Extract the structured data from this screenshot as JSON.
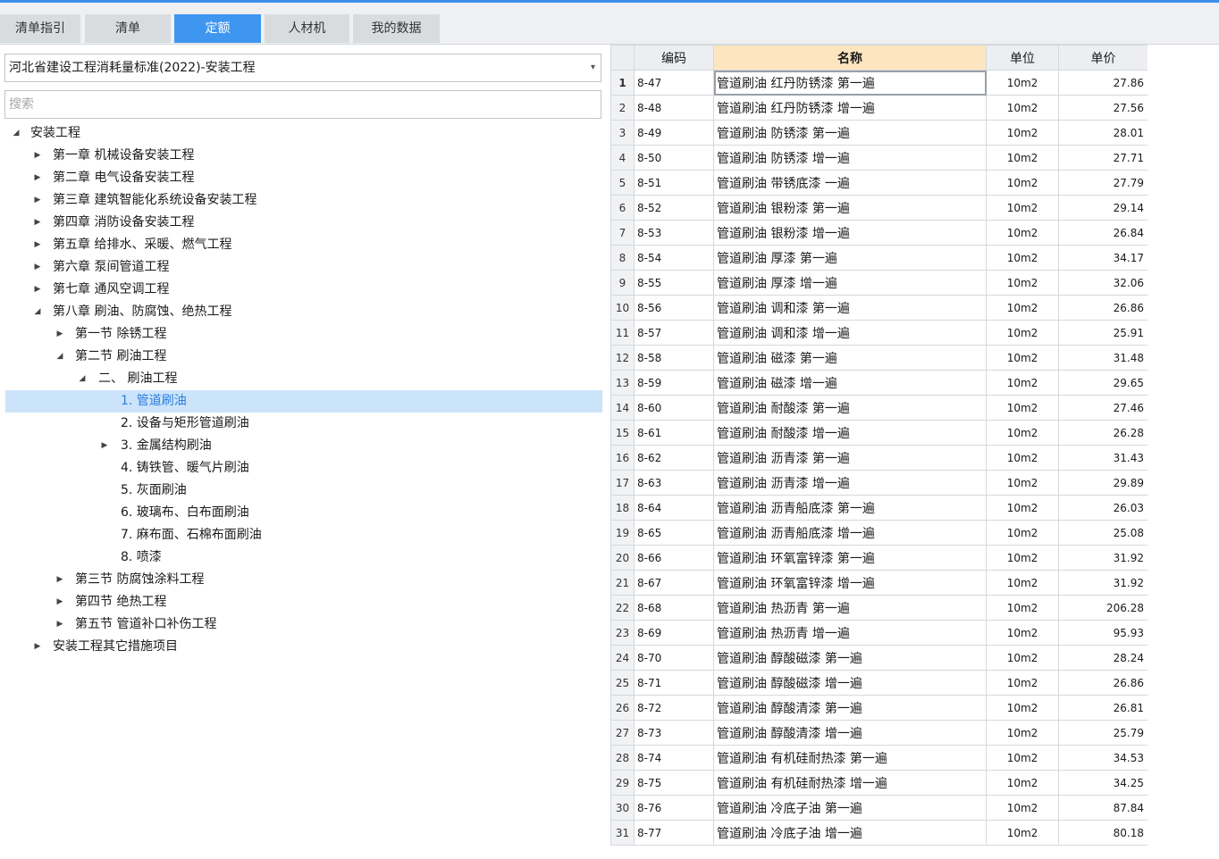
{
  "tabs": [
    {
      "label": "清单指引",
      "active": false
    },
    {
      "label": "清单",
      "active": false
    },
    {
      "label": "定额",
      "active": true
    },
    {
      "label": "人材机",
      "active": false
    },
    {
      "label": "我的数据",
      "active": false
    }
  ],
  "library": {
    "selected": "河北省建设工程消耗量标准(2022)-安装工程"
  },
  "search": {
    "placeholder": "搜索",
    "value": ""
  },
  "tree": [
    {
      "label": "安装工程",
      "level": 0,
      "toggle": "expanded"
    },
    {
      "label": "第一章 机械设备安装工程",
      "level": 1,
      "toggle": "collapsed"
    },
    {
      "label": "第二章 电气设备安装工程",
      "level": 1,
      "toggle": "collapsed"
    },
    {
      "label": "第三章 建筑智能化系统设备安装工程",
      "level": 1,
      "toggle": "collapsed"
    },
    {
      "label": "第四章 消防设备安装工程",
      "level": 1,
      "toggle": "collapsed"
    },
    {
      "label": "第五章 给排水、采暖、燃气工程",
      "level": 1,
      "toggle": "collapsed"
    },
    {
      "label": "第六章 泵间管道工程",
      "level": 1,
      "toggle": "collapsed"
    },
    {
      "label": "第七章 通风空调工程",
      "level": 1,
      "toggle": "collapsed"
    },
    {
      "label": "第八章 刷油、防腐蚀、绝热工程",
      "level": 1,
      "toggle": "expanded"
    },
    {
      "label": "第一节 除锈工程",
      "level": 2,
      "toggle": "collapsed"
    },
    {
      "label": "第二节 刷油工程",
      "level": 2,
      "toggle": "expanded"
    },
    {
      "label": "二、 刷油工程",
      "level": 3,
      "toggle": "expanded"
    },
    {
      "label": "1. 管道刷油",
      "level": 4,
      "toggle": "none",
      "selected": true
    },
    {
      "label": "2. 设备与矩形管道刷油",
      "level": 4,
      "toggle": "none"
    },
    {
      "label": "3. 金属结构刷油",
      "level": 4,
      "toggle": "collapsed"
    },
    {
      "label": "4. 铸铁管、暖气片刷油",
      "level": 4,
      "toggle": "none"
    },
    {
      "label": "5. 灰面刷油",
      "level": 4,
      "toggle": "none"
    },
    {
      "label": "6. 玻璃布、白布面刷油",
      "level": 4,
      "toggle": "none"
    },
    {
      "label": "7. 麻布面、石棉布面刷油",
      "level": 4,
      "toggle": "none"
    },
    {
      "label": "8. 喷漆",
      "level": 4,
      "toggle": "none"
    },
    {
      "label": "第三节 防腐蚀涂料工程",
      "level": 2,
      "toggle": "collapsed"
    },
    {
      "label": "第四节 绝热工程",
      "level": 2,
      "toggle": "collapsed"
    },
    {
      "label": "第五节 管道补口补伤工程",
      "level": 2,
      "toggle": "collapsed"
    },
    {
      "label": "安装工程其它措施项目",
      "level": 1,
      "toggle": "collapsed"
    }
  ],
  "grid": {
    "columns": [
      "编码",
      "名称",
      "单位",
      "单价"
    ],
    "rows": [
      {
        "n": "1",
        "code": "8-47",
        "name": "管道刷油 红丹防锈漆 第一遍",
        "unit": "10m2",
        "price": "27.86"
      },
      {
        "n": "2",
        "code": "8-48",
        "name": "管道刷油 红丹防锈漆 增一遍",
        "unit": "10m2",
        "price": "27.56"
      },
      {
        "n": "3",
        "code": "8-49",
        "name": "管道刷油 防锈漆 第一遍",
        "unit": "10m2",
        "price": "28.01"
      },
      {
        "n": "4",
        "code": "8-50",
        "name": "管道刷油 防锈漆 增一遍",
        "unit": "10m2",
        "price": "27.71"
      },
      {
        "n": "5",
        "code": "8-51",
        "name": "管道刷油 带锈底漆 一遍",
        "unit": "10m2",
        "price": "27.79"
      },
      {
        "n": "6",
        "code": "8-52",
        "name": "管道刷油 银粉漆 第一遍",
        "unit": "10m2",
        "price": "29.14"
      },
      {
        "n": "7",
        "code": "8-53",
        "name": "管道刷油 银粉漆 增一遍",
        "unit": "10m2",
        "price": "26.84"
      },
      {
        "n": "8",
        "code": "8-54",
        "name": "管道刷油 厚漆 第一遍",
        "unit": "10m2",
        "price": "34.17"
      },
      {
        "n": "9",
        "code": "8-55",
        "name": "管道刷油 厚漆 增一遍",
        "unit": "10m2",
        "price": "32.06"
      },
      {
        "n": "10",
        "code": "8-56",
        "name": "管道刷油 调和漆 第一遍",
        "unit": "10m2",
        "price": "26.86"
      },
      {
        "n": "11",
        "code": "8-57",
        "name": "管道刷油 调和漆 增一遍",
        "unit": "10m2",
        "price": "25.91"
      },
      {
        "n": "12",
        "code": "8-58",
        "name": "管道刷油 磁漆 第一遍",
        "unit": "10m2",
        "price": "31.48"
      },
      {
        "n": "13",
        "code": "8-59",
        "name": "管道刷油 磁漆 增一遍",
        "unit": "10m2",
        "price": "29.65"
      },
      {
        "n": "14",
        "code": "8-60",
        "name": "管道刷油 耐酸漆 第一遍",
        "unit": "10m2",
        "price": "27.46"
      },
      {
        "n": "15",
        "code": "8-61",
        "name": "管道刷油 耐酸漆 增一遍",
        "unit": "10m2",
        "price": "26.28"
      },
      {
        "n": "16",
        "code": "8-62",
        "name": "管道刷油 沥青漆 第一遍",
        "unit": "10m2",
        "price": "31.43"
      },
      {
        "n": "17",
        "code": "8-63",
        "name": "管道刷油 沥青漆 增一遍",
        "unit": "10m2",
        "price": "29.89"
      },
      {
        "n": "18",
        "code": "8-64",
        "name": "管道刷油 沥青船底漆 第一遍",
        "unit": "10m2",
        "price": "26.03"
      },
      {
        "n": "19",
        "code": "8-65",
        "name": "管道刷油 沥青船底漆 增一遍",
        "unit": "10m2",
        "price": "25.08"
      },
      {
        "n": "20",
        "code": "8-66",
        "name": "管道刷油 环氧富锌漆 第一遍",
        "unit": "10m2",
        "price": "31.92"
      },
      {
        "n": "21",
        "code": "8-67",
        "name": "管道刷油 环氧富锌漆 增一遍",
        "unit": "10m2",
        "price": "31.92"
      },
      {
        "n": "22",
        "code": "8-68",
        "name": "管道刷油 热沥青 第一遍",
        "unit": "10m2",
        "price": "206.28"
      },
      {
        "n": "23",
        "code": "8-69",
        "name": "管道刷油 热沥青 增一遍",
        "unit": "10m2",
        "price": "95.93"
      },
      {
        "n": "24",
        "code": "8-70",
        "name": "管道刷油 醇酸磁漆 第一遍",
        "unit": "10m2",
        "price": "28.24"
      },
      {
        "n": "25",
        "code": "8-71",
        "name": "管道刷油 醇酸磁漆 增一遍",
        "unit": "10m2",
        "price": "26.86"
      },
      {
        "n": "26",
        "code": "8-72",
        "name": "管道刷油 醇酸清漆 第一遍",
        "unit": "10m2",
        "price": "26.81"
      },
      {
        "n": "27",
        "code": "8-73",
        "name": "管道刷油 醇酸清漆 增一遍",
        "unit": "10m2",
        "price": "25.79"
      },
      {
        "n": "28",
        "code": "8-74",
        "name": "管道刷油 有机硅耐热漆 第一遍",
        "unit": "10m2",
        "price": "34.53"
      },
      {
        "n": "29",
        "code": "8-75",
        "name": "管道刷油 有机硅耐热漆 增一遍",
        "unit": "10m2",
        "price": "34.25"
      },
      {
        "n": "30",
        "code": "8-76",
        "name": "管道刷油 冷底子油 第一遍",
        "unit": "10m2",
        "price": "87.84"
      },
      {
        "n": "31",
        "code": "8-77",
        "name": "管道刷油 冷底子油 增一遍",
        "unit": "10m2",
        "price": "80.18"
      }
    ]
  },
  "colors": {
    "accent": "#3f96f0",
    "selection": "#cce4fa",
    "sorted_header": "#fde6bf"
  },
  "icons": {
    "expanded": "triangle-down-icon",
    "collapsed": "triangle-right-icon",
    "dropdown": "chevron-down-icon"
  }
}
